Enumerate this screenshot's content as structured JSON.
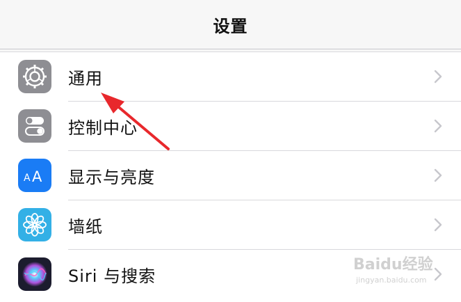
{
  "header": {
    "title": "设置"
  },
  "settings": {
    "items": [
      {
        "label": "通用",
        "icon": "gear-icon",
        "icon_bg": "#8e8e93"
      },
      {
        "label": "控制中心",
        "icon": "toggles-icon",
        "icon_bg": "#8e8e93"
      },
      {
        "label": "显示与亮度",
        "icon": "aa-icon",
        "icon_bg": "#1a7cf5",
        "icon_text": "AA"
      },
      {
        "label": "墙纸",
        "icon": "flower-icon",
        "icon_bg": "#33b0e6"
      },
      {
        "label": "Siri 与搜索",
        "icon": "siri-icon",
        "icon_bg": "#1c1c2e"
      }
    ]
  },
  "watermark": {
    "text": "Baidu经验",
    "sub": "jingyan.baidu.com"
  },
  "colors": {
    "annotation_arrow": "#e8282c",
    "chevron": "#c7c7cc"
  }
}
